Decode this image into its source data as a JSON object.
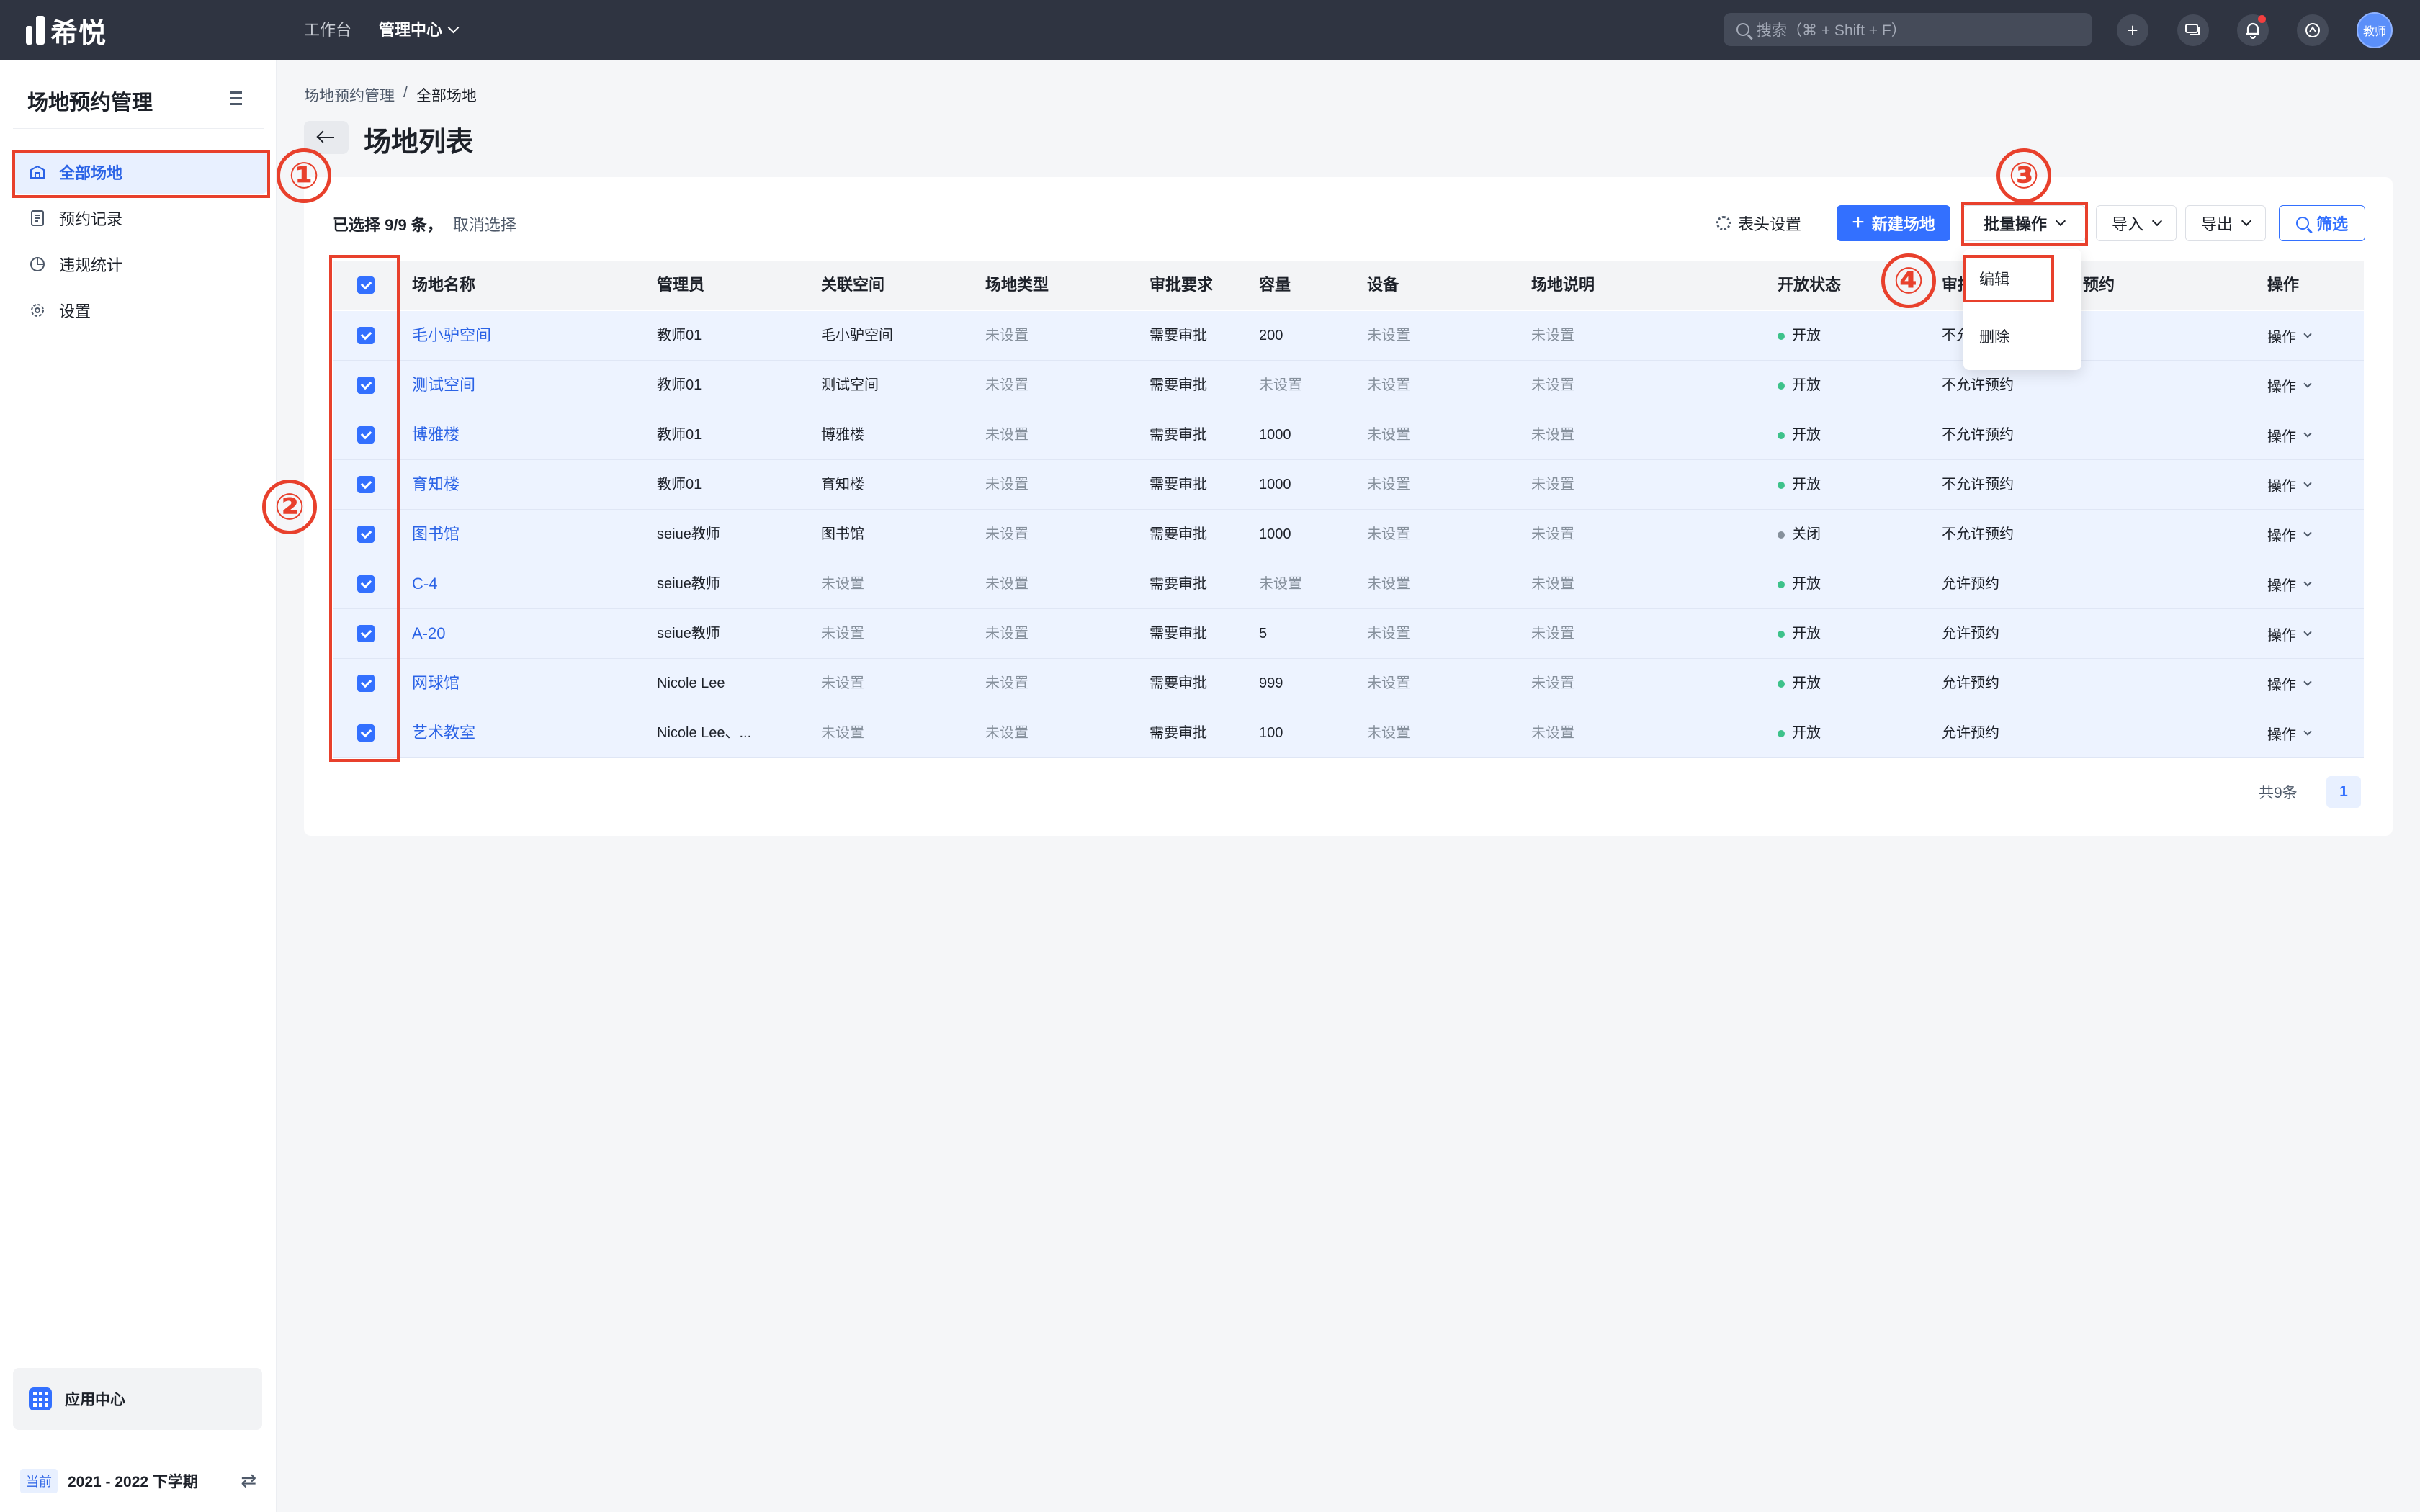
{
  "topbar": {
    "logo_text": "希悦",
    "nav": [
      "工作台",
      "管理中心"
    ],
    "search_placeholder": "搜索（⌘ + Shift + F）",
    "avatar_text": "教师"
  },
  "sidebar": {
    "title": "场地预约管理",
    "items": [
      {
        "label": "全部场地",
        "icon": "building-icon",
        "active": true
      },
      {
        "label": "预约记录",
        "icon": "document-icon",
        "active": false
      },
      {
        "label": "违规统计",
        "icon": "pie-chart-icon",
        "active": false
      },
      {
        "label": "设置",
        "icon": "gear-icon",
        "active": false
      }
    ],
    "app_center": "应用中心",
    "term_badge": "当前",
    "term": "2021 - 2022 下学期"
  },
  "breadcrumb": [
    "场地预约管理",
    "/",
    "全部场地"
  ],
  "page_title": "场地列表",
  "selection": {
    "summary": "已选择 9/9 条，",
    "cancel": "取消选择"
  },
  "toolbar": {
    "column_settings": "表头设置",
    "new_venue": "新建场地",
    "batch": "批量操作",
    "import": "导入",
    "export": "导出",
    "filter": "筛选"
  },
  "batch_menu": [
    "编辑",
    "删除"
  ],
  "table": {
    "headers": [
      "场地名称",
      "管理员",
      "关联空间",
      "场地类型",
      "审批要求",
      "容量",
      "设备",
      "场地说明",
      "开放状态",
      "审批",
      "预约",
      "操作"
    ],
    "rows": [
      {
        "name": "毛小驴空间",
        "admin": "教师01",
        "space": "毛小驴空间",
        "type": "未设置",
        "approval": "需要审批",
        "capacity": "200",
        "equipment": "未设置",
        "desc": "未设置",
        "status": "开放",
        "booking": "不允许预约",
        "op": "操作"
      },
      {
        "name": "测试空间",
        "admin": "教师01",
        "space": "测试空间",
        "type": "未设置",
        "approval": "需要审批",
        "capacity": "未设置",
        "equipment": "未设置",
        "desc": "未设置",
        "status": "开放",
        "booking": "不允许预约",
        "op": "操作"
      },
      {
        "name": "博雅楼",
        "admin": "教师01",
        "space": "博雅楼",
        "type": "未设置",
        "approval": "需要审批",
        "capacity": "1000",
        "equipment": "未设置",
        "desc": "未设置",
        "status": "开放",
        "booking": "不允许预约",
        "op": "操作"
      },
      {
        "name": "育知楼",
        "admin": "教师01",
        "space": "育知楼",
        "type": "未设置",
        "approval": "需要审批",
        "capacity": "1000",
        "equipment": "未设置",
        "desc": "未设置",
        "status": "开放",
        "booking": "不允许预约",
        "op": "操作"
      },
      {
        "name": "图书馆",
        "admin": "seiue教师",
        "space": "图书馆",
        "type": "未设置",
        "approval": "需要审批",
        "capacity": "1000",
        "equipment": "未设置",
        "desc": "未设置",
        "status": "关闭",
        "booking": "不允许预约",
        "op": "操作"
      },
      {
        "name": "C-4",
        "admin": "seiue教师",
        "space": "未设置",
        "type": "未设置",
        "approval": "需要审批",
        "capacity": "未设置",
        "equipment": "未设置",
        "desc": "未设置",
        "status": "开放",
        "booking": "允许预约",
        "op": "操作"
      },
      {
        "name": "A-20",
        "admin": "seiue教师",
        "space": "未设置",
        "type": "未设置",
        "approval": "需要审批",
        "capacity": "5",
        "equipment": "未设置",
        "desc": "未设置",
        "status": "开放",
        "booking": "允许预约",
        "op": "操作"
      },
      {
        "name": "网球馆",
        "admin": "Nicole Lee",
        "space": "未设置",
        "type": "未设置",
        "approval": "需要审批",
        "capacity": "999",
        "equipment": "未设置",
        "desc": "未设置",
        "status": "开放",
        "booking": "允许预约",
        "op": "操作"
      },
      {
        "name": "艺术教室",
        "admin": "Nicole Lee、...",
        "space": "未设置",
        "type": "未设置",
        "approval": "需要审批",
        "capacity": "100",
        "equipment": "未设置",
        "desc": "未设置",
        "status": "开放",
        "booking": "允许预约",
        "op": "操作"
      }
    ]
  },
  "pagination": {
    "total": "共9条",
    "current": "1"
  },
  "annotations": [
    "①",
    "②",
    "③",
    "④"
  ],
  "colors": {
    "accent": "#3370ff",
    "open": "#3ec28b",
    "closed": "#86909c",
    "annotation": "#e8402c"
  }
}
